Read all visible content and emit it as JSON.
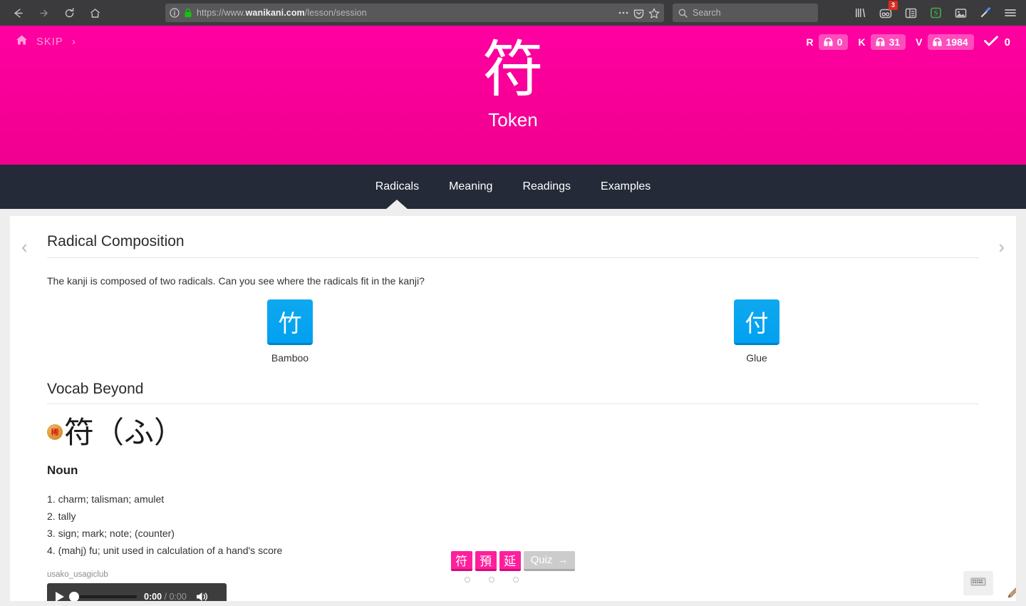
{
  "browser": {
    "url_prefix": "https://www.",
    "url_domain": "wanikani.com",
    "url_path": "/lesson/session",
    "search_placeholder": "Search",
    "extension_badge_count": "3",
    "icons": {
      "back": "back-arrow-icon",
      "forward": "forward-arrow-icon",
      "reload": "reload-icon",
      "home": "home-icon",
      "info": "page-info-icon",
      "lock": "https-lock-icon",
      "page_actions": "ellipsis-icon",
      "pocket": "pocket-icon",
      "bookmark": "star-icon",
      "search": "search-icon",
      "library": "library-icon",
      "extension": "robot-extension-icon",
      "sidebar": "sidebar-icon",
      "evernote": "evernote-s-icon",
      "screenshot": "image-icon",
      "eyedropper": "eyedropper-icon",
      "menu": "hamburger-menu-icon"
    }
  },
  "lesson_header": {
    "skip_label": "SKIP",
    "skip_chevron": "›",
    "home_icon": "home-icon",
    "character": "符",
    "meaning": "Token",
    "counters": [
      {
        "letter": "R",
        "value": "0"
      },
      {
        "letter": "K",
        "value": "31"
      },
      {
        "letter": "V",
        "value": "1984"
      }
    ],
    "completed_icon": "checkmark-icon",
    "completed_count": "0",
    "background_color": "#ff00a1"
  },
  "tabs": [
    {
      "label": "Radicals",
      "active": true
    },
    {
      "label": "Meaning",
      "active": false
    },
    {
      "label": "Readings",
      "active": false
    },
    {
      "label": "Examples",
      "active": false
    }
  ],
  "content": {
    "prev_arrow": "‹",
    "next_arrow": "›",
    "radical_section": {
      "title": "Radical Composition",
      "description": "The kanji is composed of two radicals. Can you see where the radicals fit in the kanji?",
      "radicals": [
        {
          "character": "竹",
          "label": "Bamboo"
        },
        {
          "character": "付",
          "label": "Glue"
        }
      ],
      "tile_color": "#00a1f1"
    },
    "vocab_section": {
      "title": "Vocab Beyond",
      "rarity_badge": "稀",
      "word": "符（ふ）",
      "part_of_speech": "Noun",
      "definitions": [
        "1. charm; talisman; amulet",
        "2. tally",
        "3. sign; mark; note; (counter)",
        "4. (mahj) fu; unit used in calculation of a hand's score"
      ],
      "attribution": "usako_usagiclub",
      "audio": {
        "play_icon": "play-icon",
        "current_time": "0:00",
        "separator": "/",
        "total_time": "0:00",
        "volume_icon": "volume-icon"
      }
    },
    "bottom_nav": {
      "chips": [
        "符",
        "預",
        "延"
      ],
      "quiz_label": "Quiz",
      "quiz_arrow": "→",
      "dots": 3
    },
    "keyboard_icon": "keyboard-icon",
    "pencil_icon": "pencil-icon"
  }
}
